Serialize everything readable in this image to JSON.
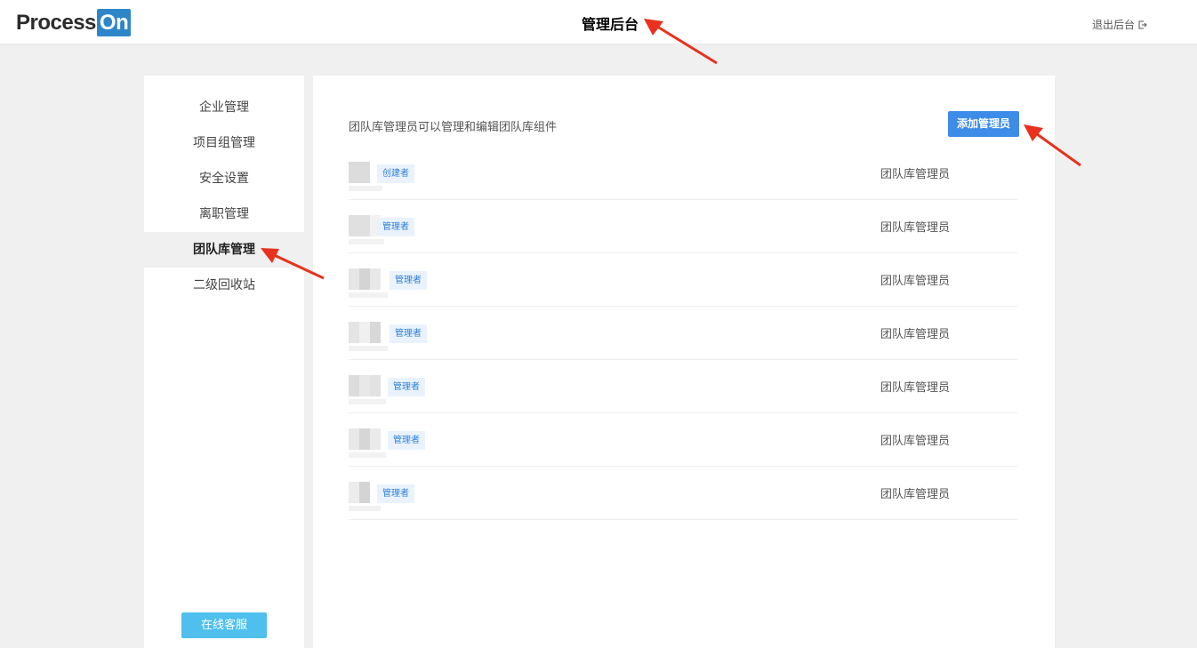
{
  "brand": {
    "part1": "Process",
    "part2": "On"
  },
  "header": {
    "title": "管理后台",
    "logout_label": "退出后台"
  },
  "sidebar": {
    "items": [
      {
        "label": "企业管理",
        "active": false
      },
      {
        "label": "项目组管理",
        "active": false
      },
      {
        "label": "安全设置",
        "active": false
      },
      {
        "label": "离职管理",
        "active": false
      },
      {
        "label": "团队库管理",
        "active": true
      },
      {
        "label": "二级回收站",
        "active": false
      }
    ],
    "support_label": "在线客服"
  },
  "main": {
    "description": "团队库管理员可以管理和编辑团队库组件",
    "add_button_label": "添加管理员",
    "members": [
      {
        "tag": "创建者",
        "role": "团队库管理员"
      },
      {
        "tag": "管理者",
        "role": "团队库管理员"
      },
      {
        "tag": "管理者",
        "role": "团队库管理员"
      },
      {
        "tag": "管理者",
        "role": "团队库管理员"
      },
      {
        "tag": "管理者",
        "role": "团队库管理员"
      },
      {
        "tag": "管理者",
        "role": "团队库管理员"
      },
      {
        "tag": "管理者",
        "role": "团队库管理员"
      }
    ]
  },
  "colors": {
    "accent": "#3d8de8",
    "support": "#4fc0ee",
    "annotation": "#e8321e"
  }
}
